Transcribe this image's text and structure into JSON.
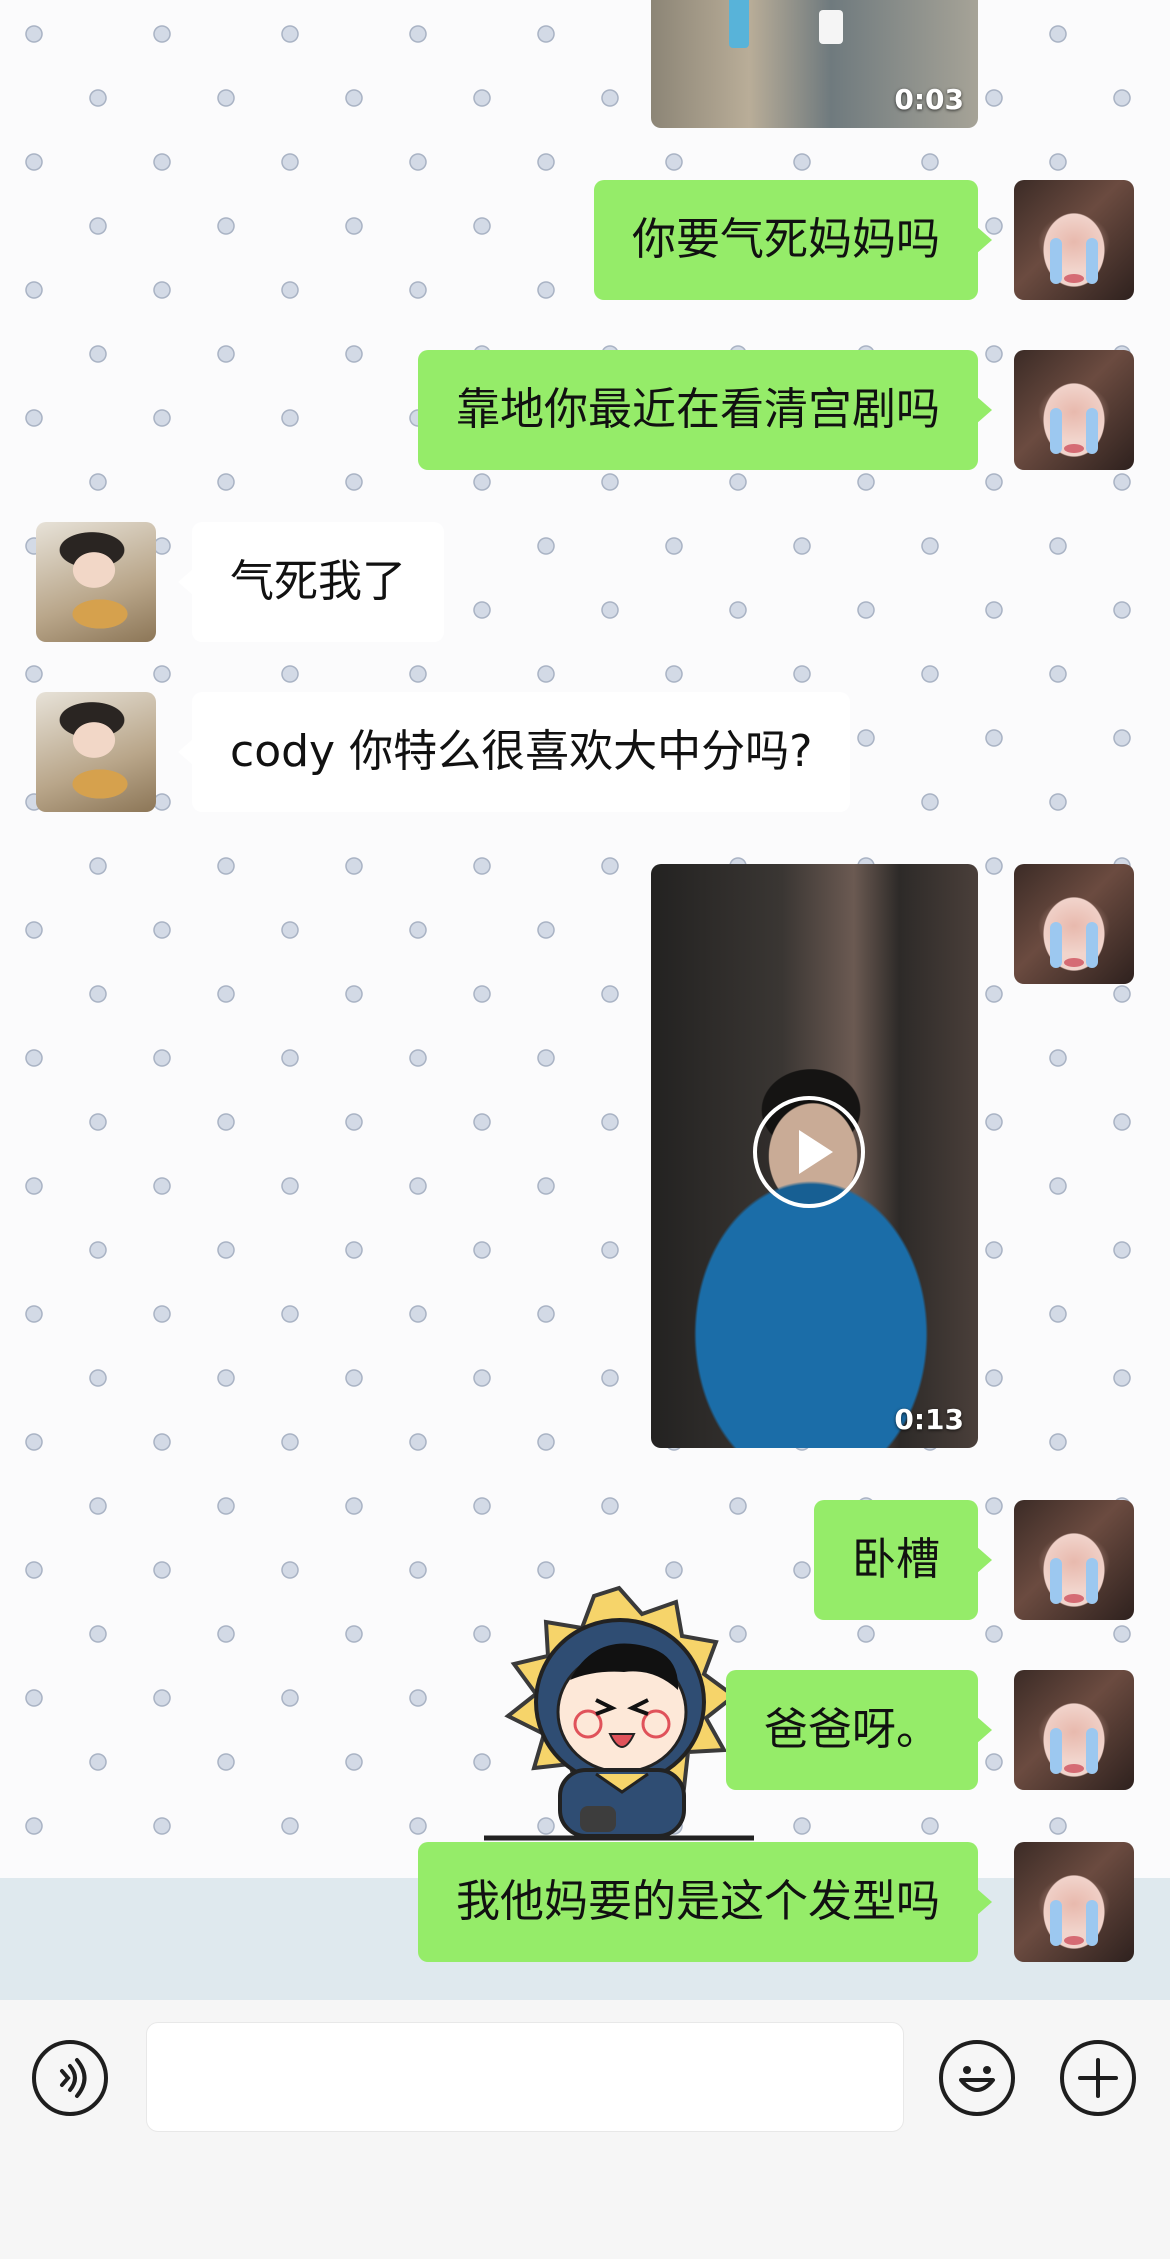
{
  "messages": [
    {
      "kind": "video",
      "side": "out",
      "duration": "0:03"
    },
    {
      "kind": "text",
      "side": "out",
      "text": "你要气死妈妈吗"
    },
    {
      "kind": "text",
      "side": "out",
      "text": "靠地你最近在看清宫剧吗"
    },
    {
      "kind": "text",
      "side": "in",
      "text": "气死我了"
    },
    {
      "kind": "text",
      "side": "in",
      "text": "cody 你特么很喜欢大中分吗?"
    },
    {
      "kind": "video",
      "side": "out",
      "duration": "0:13"
    },
    {
      "kind": "text",
      "side": "out",
      "text": "卧槽"
    },
    {
      "kind": "sticker",
      "side": "out",
      "icon": "cartoon-boy-sun-sticker"
    },
    {
      "kind": "text",
      "side": "out",
      "text": "爸爸呀。"
    },
    {
      "kind": "text",
      "side": "out",
      "text": "我他妈要的是这个发型吗"
    }
  ],
  "input_bar": {
    "voice_icon": "voice-icon",
    "message_placeholder": "",
    "emoji_icon": "emoji-icon",
    "more_icon": "plus-icon"
  },
  "colors": {
    "outgoing_bubble": "#95ec69",
    "incoming_bubble": "#ffffff",
    "chat_background": "#fbfbfc",
    "input_bar": "#f6f6f6"
  }
}
